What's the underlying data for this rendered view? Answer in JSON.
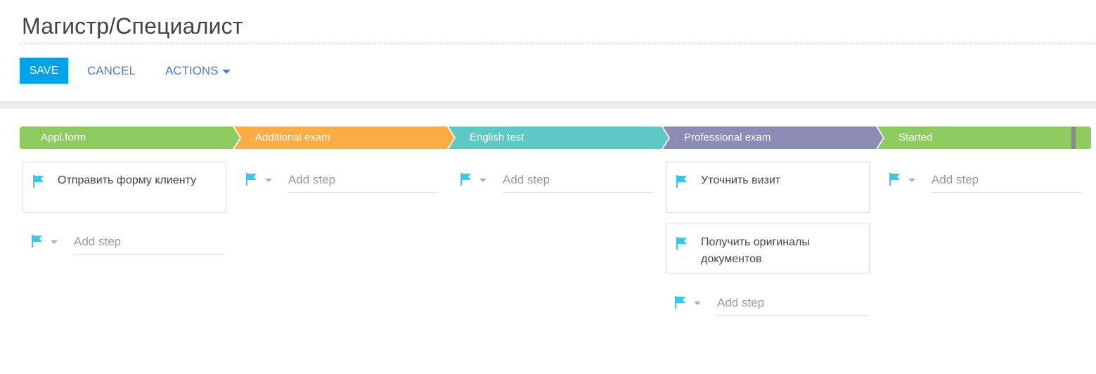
{
  "page": {
    "title": "Магистр/Специалист"
  },
  "toolbar": {
    "save_label": "SAVE",
    "cancel_label": "CANCEL",
    "actions_label": "ACTIONS"
  },
  "colors": {
    "accent": "#00a2e8",
    "link": "#4a7ec0",
    "flag": "#3bc8e8"
  },
  "stages": [
    {
      "label": "Appl.form",
      "color": "#8ecb60"
    },
    {
      "label": "Additional exam",
      "color": "#f8ad47"
    },
    {
      "label": "English test",
      "color": "#5ec9c4"
    },
    {
      "label": "Professional exam",
      "color": "#8c8bb5"
    },
    {
      "label": "Started",
      "color": "#8ecb60"
    }
  ],
  "columns": [
    {
      "steps": [
        "Отправить форму клиенту"
      ],
      "add_step_placeholder": "Add step"
    },
    {
      "steps": [],
      "add_step_placeholder": "Add step"
    },
    {
      "steps": [],
      "add_step_placeholder": "Add step"
    },
    {
      "steps": [
        "Уточнить визит",
        "Получить оригиналы документов"
      ],
      "add_step_placeholder": "Add step"
    },
    {
      "steps": [],
      "add_step_placeholder": "Add step"
    }
  ]
}
